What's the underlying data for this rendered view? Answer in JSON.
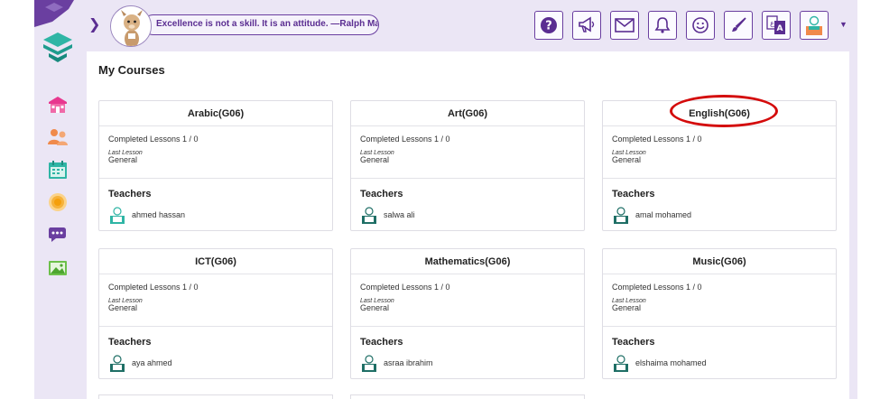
{
  "header": {
    "quote": "Excellence is not a skill. It is an attitude. —Ralph Marston",
    "toolbar": [
      {
        "name": "help-icon"
      },
      {
        "name": "megaphone-icon"
      },
      {
        "name": "mail-icon"
      },
      {
        "name": "bell-icon"
      },
      {
        "name": "smiley-icon"
      },
      {
        "name": "paintbrush-icon"
      },
      {
        "name": "translate-icon"
      },
      {
        "name": "user-avatar-icon"
      }
    ]
  },
  "sidebar": {
    "items": [
      {
        "name": "school-icon"
      },
      {
        "name": "users-icon"
      },
      {
        "name": "calendar-icon"
      },
      {
        "name": "sun-icon"
      },
      {
        "name": "chat-icon"
      },
      {
        "name": "gallery-icon"
      }
    ]
  },
  "main": {
    "title": "My Courses",
    "courses": [
      {
        "title": "Arabic(G06)",
        "completed": "Completed Lessons 1 / 0",
        "last_lesson_label": "Last Lesson",
        "last_lesson": "General",
        "teachers_label": "Teachers",
        "teacher": "ahmed hassan"
      },
      {
        "title": "Art(G06)",
        "completed": "Completed Lessons 1 / 0",
        "last_lesson_label": "Last Lesson",
        "last_lesson": "General",
        "teachers_label": "Teachers",
        "teacher": "salwa ali"
      },
      {
        "title": "English(G06)",
        "completed": "Completed Lessons 1 / 0",
        "last_lesson_label": "Last Lesson",
        "last_lesson": "General",
        "teachers_label": "Teachers",
        "teacher": "amal mohamed"
      },
      {
        "title": "ICT(G06)",
        "completed": "Completed Lessons 1 / 0",
        "last_lesson_label": "Last Lesson",
        "last_lesson": "General",
        "teachers_label": "Teachers",
        "teacher": "aya ahmed"
      },
      {
        "title": "Mathematics(G06)",
        "completed": "Completed Lessons 1 / 0",
        "last_lesson_label": "Last Lesson",
        "last_lesson": "General",
        "teachers_label": "Teachers",
        "teacher": "asraa ibrahim"
      },
      {
        "title": "Music(G06)",
        "completed": "Completed Lessons 1 / 0",
        "last_lesson_label": "Last Lesson",
        "last_lesson": "General",
        "teachers_label": "Teachers",
        "teacher": "elshaima mohamed"
      }
    ]
  },
  "colors": {
    "accent": "#5a2d91",
    "background": "#ebe6f5",
    "nav_icon_pink": "#e8388f",
    "nav_icon_orange": "#f08a4b",
    "nav_icon_teal": "#2fb5a5",
    "highlight": "#d40b0b"
  }
}
